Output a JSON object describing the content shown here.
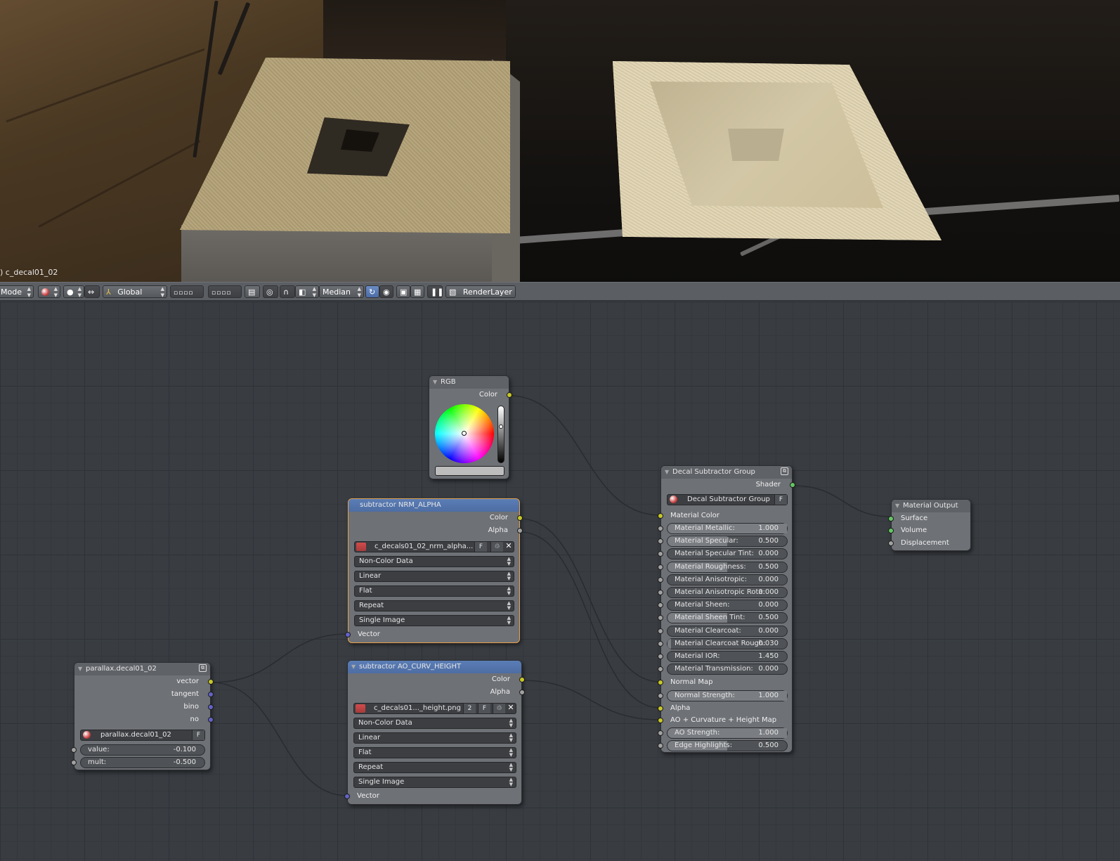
{
  "viewport": {
    "object_label": ") c_decal01_02"
  },
  "toolbar": {
    "mode_label": "Mode",
    "orientation": "Global",
    "pivot": "Median",
    "render_layer": "RenderLayer"
  },
  "nodes": {
    "rgb": {
      "title": "RGB",
      "output_color": "Color"
    },
    "nrm_alpha": {
      "title": "subtractor NRM_ALPHA",
      "outputs": [
        "Color",
        "Alpha"
      ],
      "image_name": "c_decals01_02_nrm_alpha....",
      "f_label": "F",
      "selects": [
        "Non-Color Data",
        "Linear",
        "Flat",
        "Repeat",
        "Single Image"
      ],
      "input_vector": "Vector"
    },
    "ao_curv_height": {
      "title": "subtractor AO_CURV_HEIGHT",
      "outputs": [
        "Color",
        "Alpha"
      ],
      "image_name": "c_decals01..._height.png",
      "users": "2",
      "f_label": "F",
      "selects": [
        "Non-Color Data",
        "Linear",
        "Flat",
        "Repeat",
        "Single Image"
      ],
      "input_vector": "Vector"
    },
    "parallax": {
      "title": "parallax.decal01_02",
      "outputs": [
        "vector",
        "tangent",
        "bino",
        "no"
      ],
      "group_name": "parallax.decal01_02",
      "f_label": "F",
      "fields": [
        {
          "label": "value:",
          "value": "-0.100"
        },
        {
          "label": "mult:",
          "value": "-0.500"
        }
      ]
    },
    "decal_group": {
      "title": "Decal Subtractor Group",
      "output_shader": "Shader",
      "group_name": "Decal Subtractor Group",
      "f_label": "F",
      "material_color": "Material Color",
      "fields": [
        {
          "label": "Material Metallic:",
          "value": "1.000",
          "fill": 1.0
        },
        {
          "label": "Material Specular:",
          "value": "0.500",
          "fill": 0.5
        },
        {
          "label": "Material Specular Tint:",
          "value": "0.000",
          "fill": 0.0
        },
        {
          "label": "Material Roughness:",
          "value": "0.500",
          "fill": 0.5
        },
        {
          "label": "Material Anisotropic:",
          "value": "0.000",
          "fill": 0.0
        },
        {
          "label": "Material Anisotropic Rota:",
          "value": "0.000",
          "fill": 0.0
        },
        {
          "label": "Material Sheen:",
          "value": "0.000",
          "fill": 0.0
        },
        {
          "label": "Material Sheen Tint:",
          "value": "0.500",
          "fill": 0.5
        },
        {
          "label": "Material Clearcoat:",
          "value": "0.000",
          "fill": 0.0
        },
        {
          "label": "Material Clearcoat Rough:",
          "value": "0.030",
          "fill": 0.03
        },
        {
          "label": "Material IOR:",
          "value": "1.450",
          "fill": 0.0
        },
        {
          "label": "Material Transmission:",
          "value": "0.000",
          "fill": 0.0
        }
      ],
      "normal_map": "Normal Map",
      "normal_strength": {
        "label": "Normal Strength:",
        "value": "1.000"
      },
      "alpha": "Alpha",
      "ao_map": "AO + Curvature + Height Map",
      "ao_strength": {
        "label": "AO Strength:",
        "value": "1.000",
        "fill": 1.0
      },
      "edge_highlights": {
        "label": "Edge Highlights:",
        "value": "0.500",
        "fill": 0.5
      }
    },
    "material_output": {
      "title": "Material Output",
      "inputs": [
        "Surface",
        "Volume",
        "Displacement"
      ]
    }
  },
  "colors": {
    "socket_color": "#c7c729",
    "socket_float": "#a1a1a1",
    "socket_vector": "#6363c7",
    "socket_shader": "#63c763",
    "header_blue": "#5b7db6"
  }
}
